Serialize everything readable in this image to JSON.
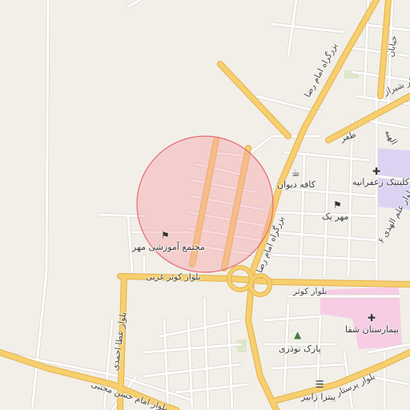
{
  "map": {
    "colors": {
      "background": "#f2efe9",
      "major_road": "#f7cf6f",
      "major_road_casing": "#e2b24a",
      "minor_road": "#ffffff",
      "minor_road_casing": "#d8d3cb",
      "hospital_area": "#f6cde4",
      "clinic_area": "#dcd3f3",
      "park_area": "#dbe8c9",
      "highlight_fill": "#f4a6aa",
      "highlight_stroke": "#e46b74"
    },
    "road_labels": {
      "imam_reza_north": "بزرگراه امام رضا",
      "imam_reza_center": "بزرگراه امام رضا",
      "kowsar_west": "بلوار کوثر غربی",
      "kowsar": "بلوار کوثر",
      "shiraz": "بلوار شیراز",
      "zafar": "ظفر",
      "ata_ahmadi": "بلوار عطا احمدی",
      "imam_hossein_mojtaba": "بلوار امام حسن مجتبی",
      "parastar": "بلوار پرستار",
      "alamol_hoda": "بلوار علم الهدی ۶",
      "kh_top": "خیابان",
      "elahie": "الهیه"
    },
    "poi_labels": {
      "school": "مجتمع آموزشی مهر",
      "cafe": "کافه دیوان",
      "clinic": "کلینیک زعفرانیه",
      "mehr": "مهر یک",
      "hospital": "بیمارستان شفا",
      "park": "پارک نوذری",
      "pizza": "پیتزا ژابیز"
    },
    "icons": {
      "school": "school-icon",
      "cafe": "cafe-icon",
      "clinic": "medical-cross-icon",
      "mehr": "school-icon",
      "hospital": "medical-cross-icon",
      "park": "tree-icon",
      "pizza": "fast-food-icon"
    }
  }
}
